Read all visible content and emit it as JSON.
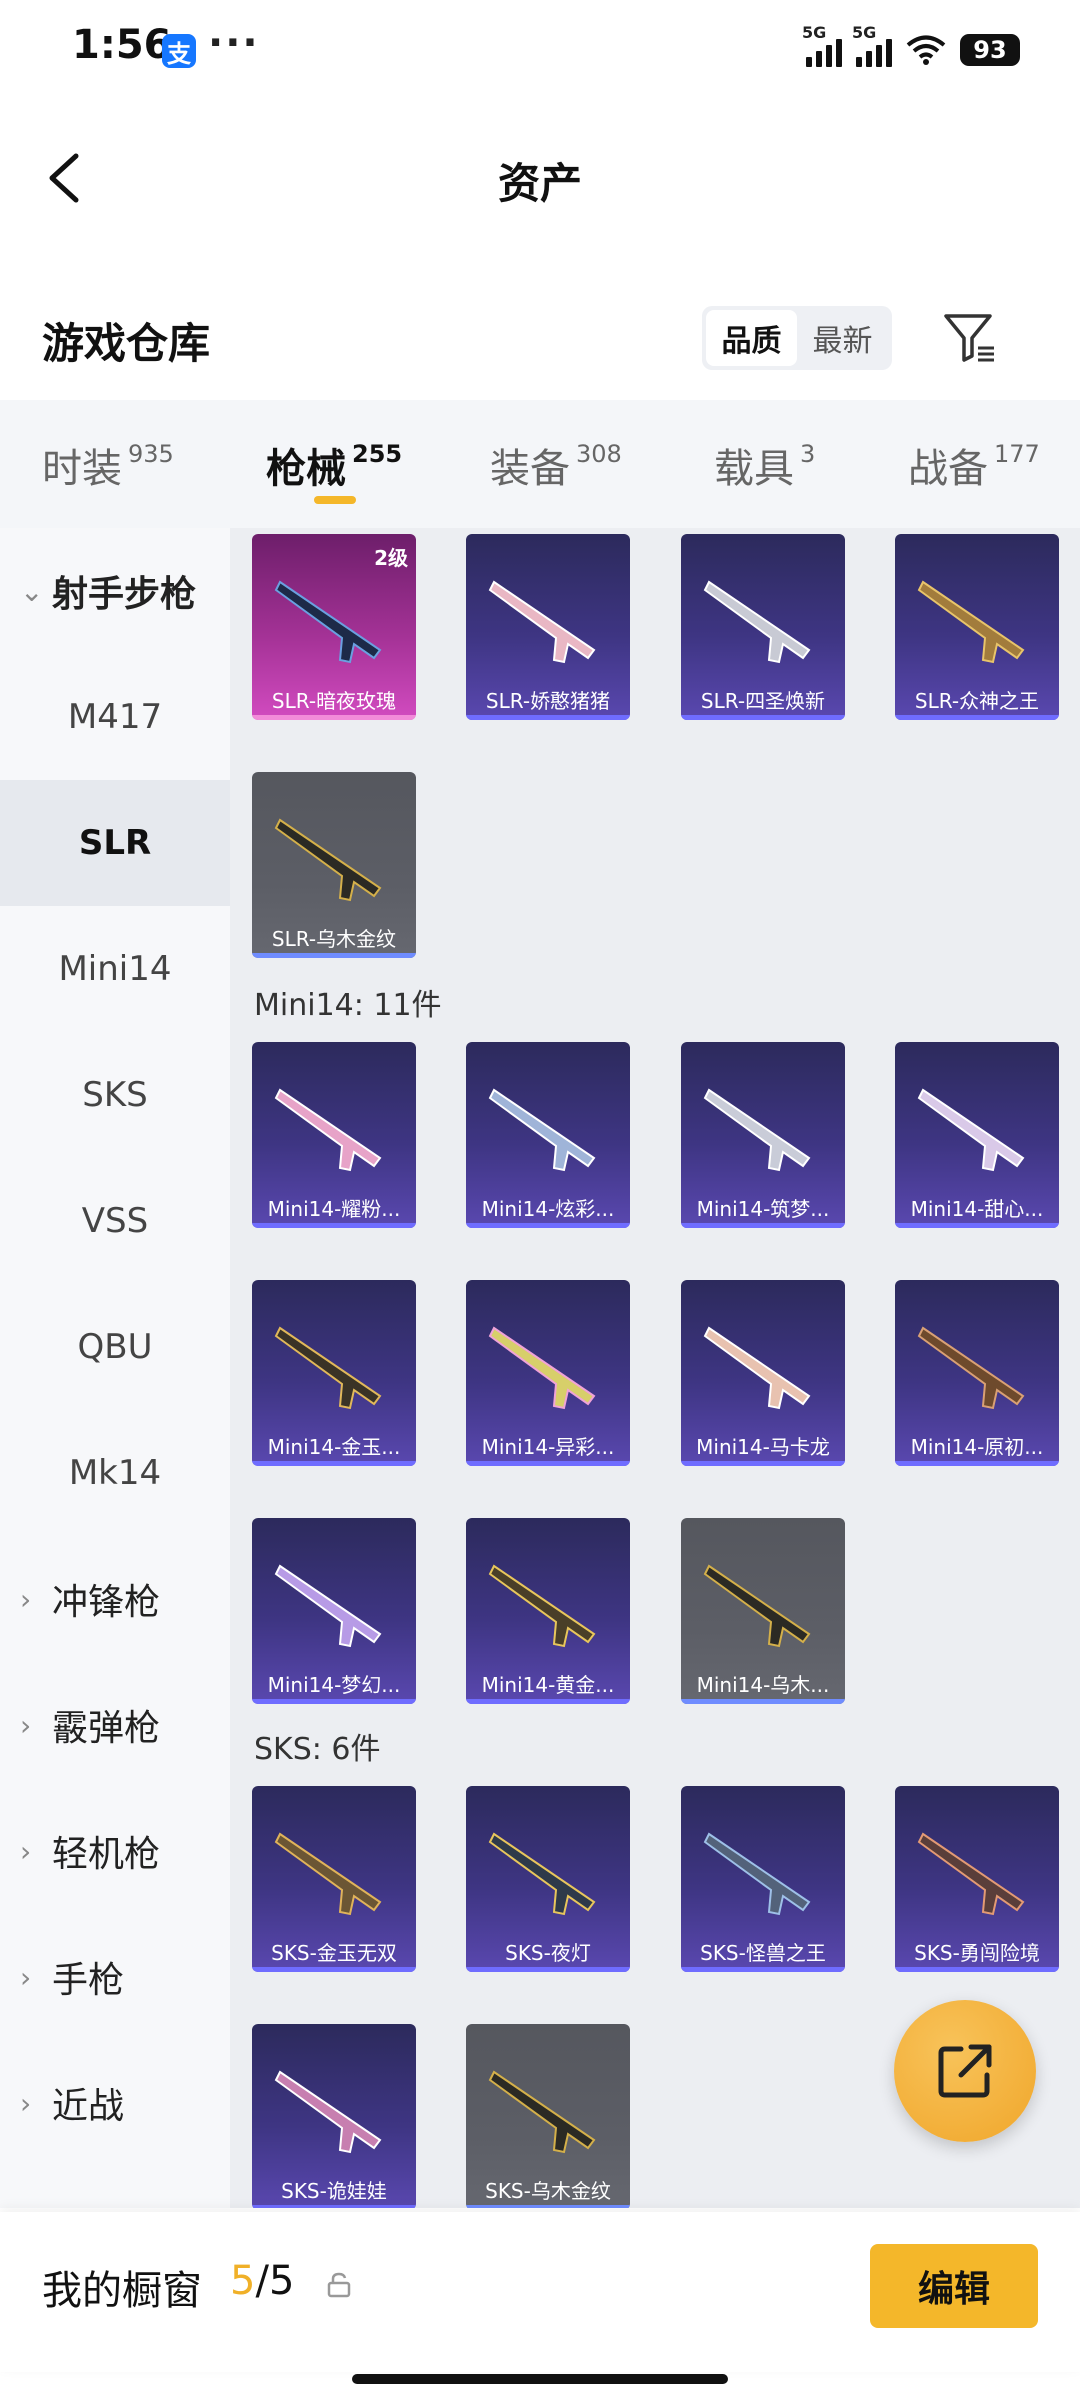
{
  "status_bar": {
    "time": "1:56",
    "alipay_glyph": "支",
    "dots": "···",
    "sig1": "5G",
    "sig2": "5G",
    "battery": "93"
  },
  "header": {
    "title": "资产"
  },
  "warehouse": {
    "title": "游戏仓库",
    "sort_quality": "品质",
    "sort_newest": "最新"
  },
  "category_tabs": [
    {
      "name": "时装",
      "count": "935"
    },
    {
      "name": "枪械",
      "count": "255"
    },
    {
      "name": "装备",
      "count": "308"
    },
    {
      "name": "载具",
      "count": "3"
    },
    {
      "name": "战备",
      "count": "177"
    }
  ],
  "sidebar": {
    "marksman": "射手步枪",
    "m417": "M417",
    "slr": "SLR",
    "mini14": "Mini14",
    "sks": "SKS",
    "vss": "VSS",
    "qbu": "QBU",
    "mk14": "Mk14",
    "smg": "冲锋枪",
    "shotgun": "霰弹枪",
    "lmg": "轻机枪",
    "pistol": "手枪",
    "melee": "近战"
  },
  "sections": {
    "mini14_heading": "Mini14: 11件",
    "sks_heading": "SKS: 6件"
  },
  "items": {
    "slr": [
      "SLR-暗夜玫瑰",
      "SLR-娇憨猪猪",
      "SLR-四圣焕新",
      "SLR-众神之王",
      "SLR-乌木金纹"
    ],
    "slr_first_level": "2级",
    "mini14": [
      "Mini14-耀粉...",
      "Mini14-炫彩...",
      "Mini14-筑梦...",
      "Mini14-甜心...",
      "Mini14-金玉...",
      "Mini14-异彩...",
      "Mini14-马卡龙",
      "Mini14-原初...",
      "Mini14-梦幻...",
      "Mini14-黄金...",
      "Mini14-乌木..."
    ],
    "sks": [
      "SKS-金玉无双",
      "SKS-夜灯",
      "SKS-怪兽之王",
      "SKS-勇闯险境",
      "SKS-诡娃娃",
      "SKS-乌木金纹"
    ]
  },
  "showcase": {
    "label": "我的橱窗",
    "used": "5",
    "separator": "/",
    "total": "5",
    "edit_label": "编辑"
  },
  "icons": {
    "back": "chevron-left-icon",
    "filter": "filter-icon",
    "share": "external-link-icon",
    "lock": "lock-icon"
  },
  "colors": {
    "accent": "#f4b72a",
    "card_purple": "#3e3583",
    "card_pink": "#a43296",
    "card_gray": "#5c5e66"
  }
}
